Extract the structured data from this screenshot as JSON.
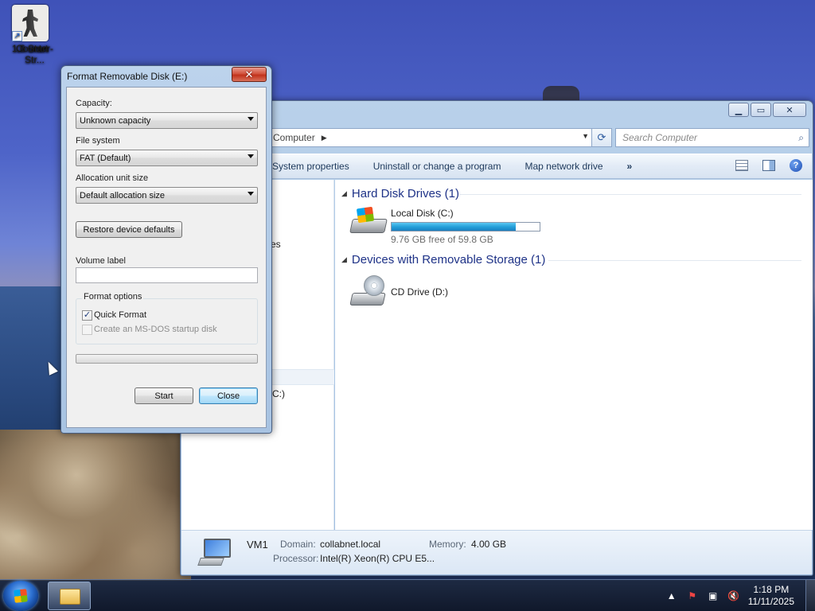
{
  "desktop": {
    "icon_label_line1": "Counter-Str...",
    "icon_label_line2": "1.6 Start"
  },
  "explorer": {
    "address_crumb": "Computer",
    "search_placeholder": "Search Computer",
    "toolbar": {
      "system_properties": "System properties",
      "uninstall": "Uninstall or change a program",
      "map_drive": "Map network drive",
      "more": "»"
    },
    "nav_fragments": {
      "partial_1": "es",
      "partial_2": "C:)"
    },
    "groups": {
      "hard_disk": "Hard Disk Drives (1)",
      "removable": "Devices with Removable Storage (1)"
    },
    "local_disk": {
      "name": "Local Disk (C:)",
      "free_text": "9.76 GB free of 59.8 GB",
      "used_fraction": 0.837
    },
    "cd_drive": {
      "name": "CD Drive (D:)"
    },
    "details": {
      "computer_name": "VM1",
      "domain_label": "Domain:",
      "domain_value": "collabnet.local",
      "memory_label": "Memory:",
      "memory_value": "4.00 GB",
      "processor_label": "Processor:",
      "processor_value": "Intel(R) Xeon(R) CPU E5..."
    }
  },
  "format_dialog": {
    "title": "Format Removable Disk (E:)",
    "close_glyph": "✕",
    "capacity_label": "Capacity:",
    "capacity_value": "Unknown capacity",
    "filesystem_label": "File system",
    "filesystem_value": "FAT (Default)",
    "allocation_label": "Allocation unit size",
    "allocation_value": "Default allocation size",
    "restore_button": "Restore device defaults",
    "volume_label": "Volume label",
    "volume_value": "",
    "format_options_label": "Format options",
    "quick_format_label": "Quick Format",
    "quick_format_checked": true,
    "msdos_label": "Create an MS-DOS startup disk",
    "msdos_checked": false,
    "msdos_enabled": false,
    "progress": 0,
    "start_button": "Start",
    "close_button": "Close"
  },
  "taskbar": {
    "time": "1:18 PM",
    "date": "11/11/2025"
  }
}
